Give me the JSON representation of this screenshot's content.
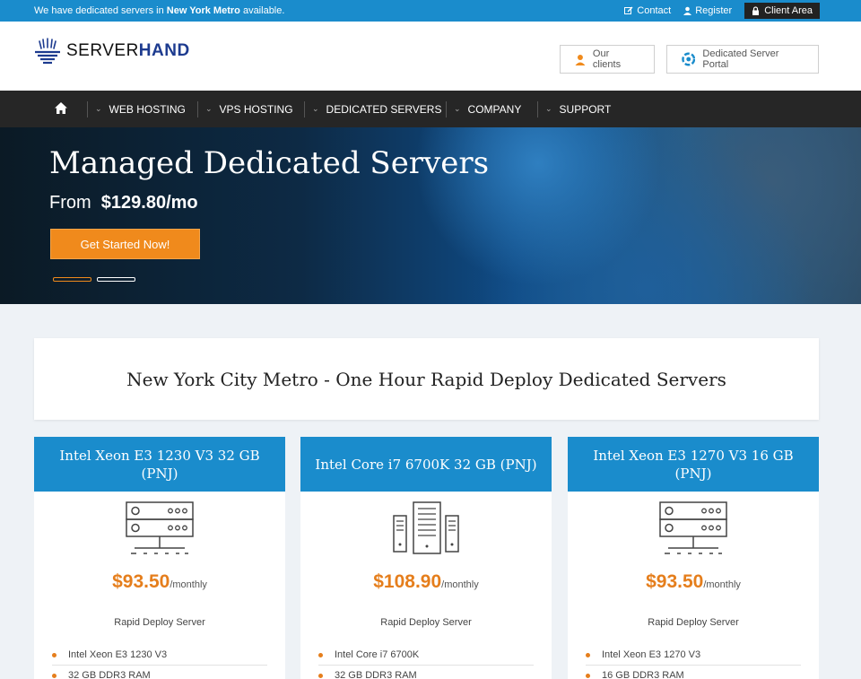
{
  "topbar": {
    "message_prefix": "We have dedicated servers in ",
    "message_bold": "New York Metro",
    "message_suffix": " available.",
    "contact": "Contact",
    "register": "Register",
    "client_area": "Client Area"
  },
  "header": {
    "logo_server": "SERVER",
    "logo_hand": "HAND",
    "our_clients": "Our clients",
    "portal": "Dedicated Server Portal"
  },
  "nav": {
    "items": [
      "WEB HOSTING",
      "VPS HOSTING",
      "DEDICATED SERVERS",
      "COMPANY",
      "SUPPORT"
    ]
  },
  "hero": {
    "title": "Managed Dedicated Servers",
    "from_label": "From",
    "from_price": "$129.80/mo",
    "cta": "Get Started Now!"
  },
  "section": {
    "title": "New York City Metro - One Hour Rapid Deploy Dedicated Servers"
  },
  "products": [
    {
      "title": "Intel Xeon E3 1230 V3 32 GB (PNJ)",
      "price": "$93.50",
      "period": "/monthly",
      "subtitle": "Rapid Deploy Server",
      "icon": "server-rack-icon",
      "features": [
        "Intel Xeon E3 1230 V3",
        "32 GB DDR3 RAM"
      ]
    },
    {
      "title": "Intel Core i7 6700K 32 GB (PNJ)",
      "price": "$108.90",
      "period": "/monthly",
      "subtitle": "Rapid Deploy Server",
      "icon": "server-towers-icon",
      "features": [
        "Intel Core i7 6700K",
        "32 GB DDR3 RAM"
      ]
    },
    {
      "title": "Intel Xeon E3 1270 V3 16 GB (PNJ)",
      "price": "$93.50",
      "period": "/monthly",
      "subtitle": "Rapid Deploy Server",
      "icon": "server-rack-icon",
      "features": [
        "Intel Xeon E3 1270 V3",
        "16 GB DDR3 RAM"
      ]
    }
  ],
  "colors": {
    "brand_blue": "#1a8ccc",
    "accent_orange": "#e57e1c",
    "nav_dark": "#262626"
  }
}
